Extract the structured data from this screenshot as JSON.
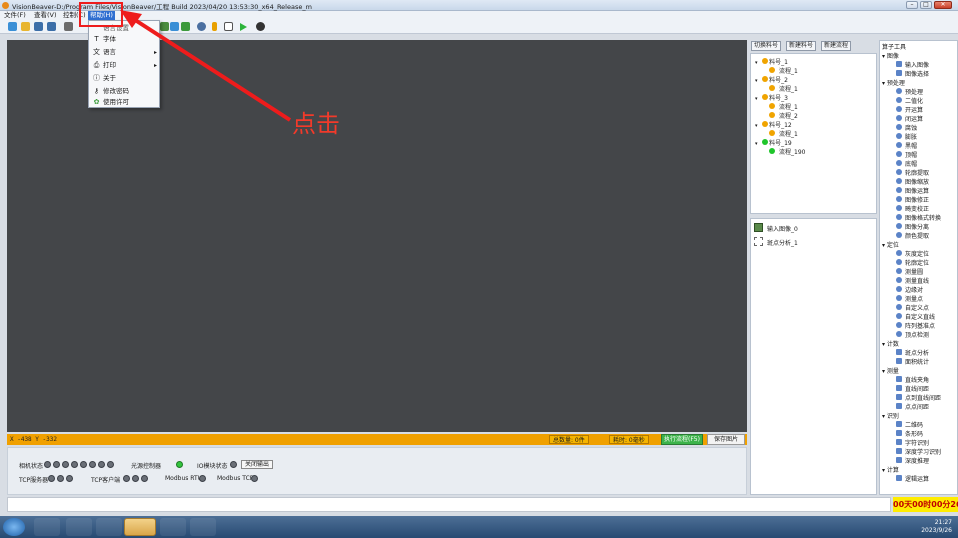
{
  "window": {
    "title": "VisionBeaver-D:/Program Files/VisionBeaver/工程    Build 2023/04/20 13:53:30_x64_Release_m",
    "controls": [
      "–",
      "□",
      "✕"
    ]
  },
  "menubar": {
    "items": [
      "文件(F)",
      "查看(V)",
      "控制(C)",
      "帮助(H)"
    ]
  },
  "help_menu": {
    "items": [
      {
        "label": "字体",
        "icon": "font-icon",
        "submenu": false
      },
      {
        "label": "语言",
        "icon": "language-icon",
        "submenu": true
      },
      {
        "label": "打印",
        "icon": "print-icon",
        "submenu": true
      },
      {
        "label": "关于",
        "icon": "info-icon",
        "submenu": false
      },
      {
        "label": "修改密码",
        "icon": "key-icon",
        "submenu": false
      },
      {
        "label": "使用许可",
        "icon": "license-icon",
        "submenu": false
      }
    ],
    "partial_item": "语言设置"
  },
  "annotation": "点击",
  "canvas": {
    "coords": "X -438  Y -332"
  },
  "status": {
    "total": "总数量: 0件",
    "time": "耗时: 0毫秒",
    "run_button": "执行流程(F5)",
    "save_image": "保存图片"
  },
  "bottom": {
    "camera_status": "相机状态",
    "camera_dots": [
      "1",
      "2",
      "3",
      "4",
      "5",
      "6",
      "7",
      "8"
    ],
    "light_controller": "光源控制器",
    "io_status": "IO模块状态",
    "close_output": "关闭输出",
    "tcp_server": "TCP服务器",
    "tcp_server_dots": [
      "1",
      "2",
      "3"
    ],
    "tcp_client": "TCP客户端",
    "tcp_client_dots": [
      "1",
      "2",
      "3"
    ],
    "modbus_rtu": "Modbus RTU",
    "modbus_tcp": "Modbus TCP"
  },
  "right_tabs": [
    "切换料号",
    "新建料号",
    "新建流程"
  ],
  "tree": [
    {
      "label": "料号_1",
      "level": 0,
      "color": "orange"
    },
    {
      "label": "流程_1",
      "level": 1,
      "color": "orange"
    },
    {
      "label": "料号_2",
      "level": 0,
      "color": "orange"
    },
    {
      "label": "流程_1",
      "level": 1,
      "color": "orange"
    },
    {
      "label": "料号_3",
      "level": 0,
      "color": "orange"
    },
    {
      "label": "流程_1",
      "level": 1,
      "color": "orange"
    },
    {
      "label": "流程_2",
      "level": 1,
      "color": "orange"
    },
    {
      "label": "料号_12",
      "level": 0,
      "color": "orange"
    },
    {
      "label": "流程_1",
      "level": 1,
      "color": "orange"
    },
    {
      "label": "料号_19",
      "level": 0,
      "color": "green"
    },
    {
      "label": "流程_190",
      "level": 1,
      "color": "green"
    }
  ],
  "flow_steps": [
    "输入图像_0",
    "斑点分析_1"
  ],
  "operators": {
    "title": "算子工具",
    "groups": [
      {
        "name": "图像",
        "items": [
          "输入图像",
          "图像选择"
        ]
      },
      {
        "name": "预处理",
        "items": [
          "预处理",
          "二值化",
          "开运算",
          "闭运算",
          "腐蚀",
          "膨胀",
          "黑帽",
          "顶帽",
          "底帽",
          "轮廓提取",
          "图像缩放",
          "图像运算",
          "图像修正",
          "畸变校正",
          "图像格式转换",
          "图像分离",
          "颜色提取"
        ]
      },
      {
        "name": "定位",
        "items": [
          "灰度定位",
          "轮廓定位",
          "测量圆",
          "测量直线",
          "边缘对",
          "测量点",
          "自定义点",
          "自定义直线",
          "阵列基准点",
          "顶点检测"
        ]
      },
      {
        "name": "计数",
        "items": [
          "斑点分析",
          "面积统计"
        ]
      },
      {
        "name": "测量",
        "items": [
          "直线夹角",
          "直线间距",
          "点到直线间距",
          "点点间距"
        ]
      },
      {
        "name": "识别",
        "items": [
          "二维码",
          "条形码",
          "字符识别",
          "深度学习识别",
          "深度推理"
        ]
      },
      {
        "name": "计算",
        "items": [
          "逻辑运算"
        ]
      }
    ]
  },
  "timer": "00天00时00分26秒",
  "taskbar": {
    "time": "21:27",
    "date": "2023/9/26"
  },
  "colors": {
    "canvas": "#444649",
    "status_bar": "#f0a000",
    "run_button": "#3cb34a",
    "annotation": "#f23a2a",
    "highlight": "#ee1c1c",
    "timer_bg": "#ffec00",
    "timer_text": "#c00000"
  }
}
